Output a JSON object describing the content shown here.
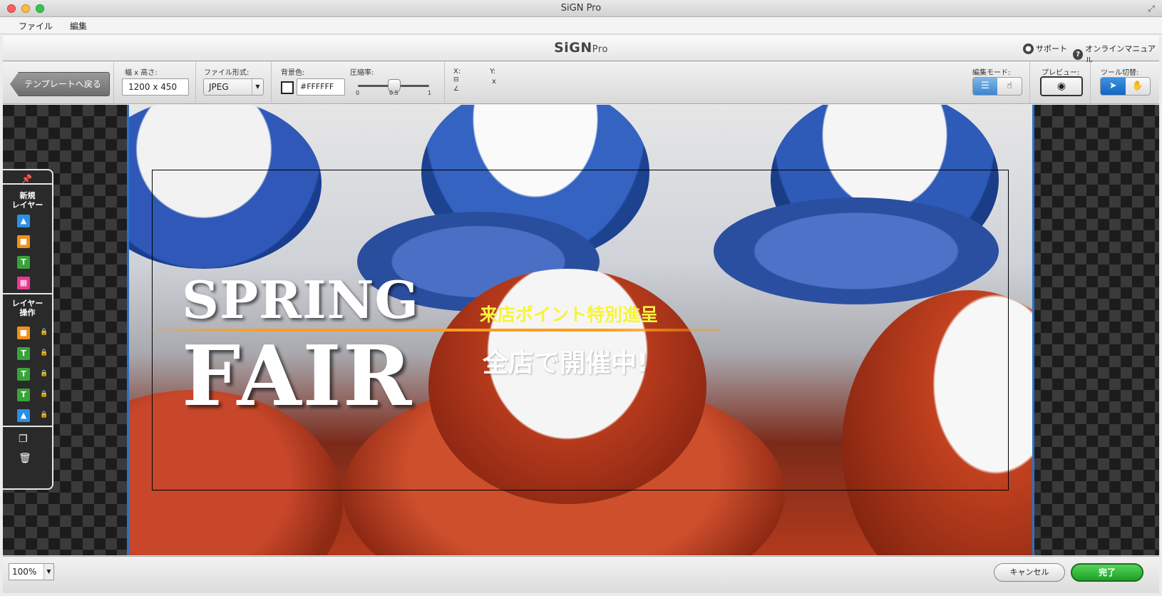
{
  "window": {
    "title": "SiGN Pro"
  },
  "menu": {
    "file": "ファイル",
    "edit": "編集"
  },
  "header": {
    "logo_main": "SiGN",
    "logo_sub": "Pro",
    "support": "サポート",
    "manual": "オンラインマニュアル"
  },
  "toolbar": {
    "back_label": "テンプレートへ戻る",
    "size_label": "幅 x 高さ:",
    "size_value": "1200 x 450",
    "format_label": "ファイル形式:",
    "format_value": "JPEG",
    "bg_label": "背景色:",
    "bg_value": "#FFFFFF",
    "compression_label": "圧縮率:",
    "compression_value": 0.5,
    "slider_min": "0",
    "slider_mid": "0.5",
    "slider_max": "1",
    "x_label": "X:",
    "y_label": "Y:",
    "size_sep": "x",
    "edit_mode_label": "編集モード:",
    "preview_label": "プレビュー:",
    "tool_switch_label": "ツール切替:"
  },
  "layer_panel": {
    "new_layer_title_1": "新規",
    "new_layer_title_2": "レイヤー",
    "ops_title_1": "レイヤー",
    "ops_title_2": "操作",
    "new_items": [
      "image",
      "shape",
      "text",
      "table"
    ],
    "layers": [
      "shape",
      "text",
      "text",
      "text",
      "image"
    ]
  },
  "canvas": {
    "headline_1": "SPRING",
    "headline_2": "FAIR",
    "promo_1": "来店ポイント特別進呈",
    "promo_2": "全店で開催中!"
  },
  "footer": {
    "zoom": "100%",
    "cancel": "キャンセル",
    "done": "完了"
  },
  "colors": {
    "done_button": "#1e9f27",
    "promo_yellow": "#f7f43a",
    "accent_line": "#ff9d1c",
    "artboard_border": "#2a72c8"
  }
}
